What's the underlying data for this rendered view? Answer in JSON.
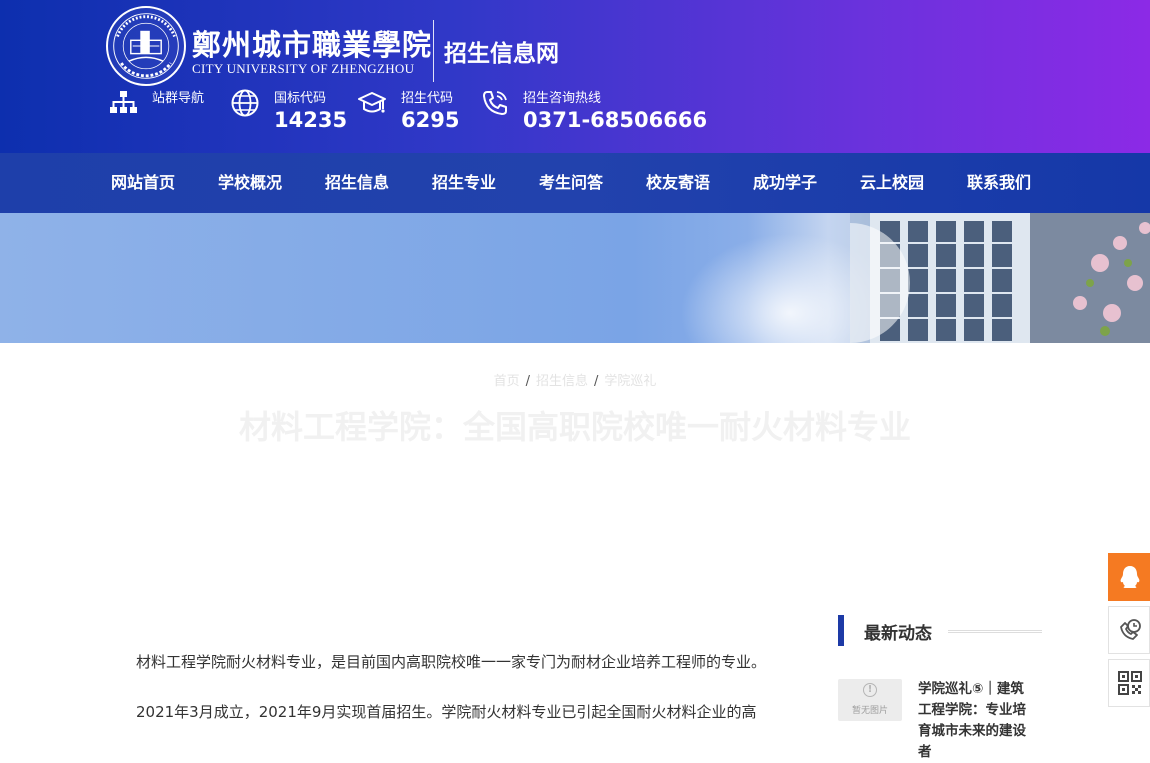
{
  "header": {
    "logo_cn": "鄭州城市職業學院",
    "logo_en": "CITY UNIVERSITY OF ZHENGZHOU",
    "site_name": "招生信息网",
    "info": [
      {
        "label": "站群导航",
        "value": "",
        "icon": "sitemap-icon"
      },
      {
        "label": "国标代码",
        "value": "14235",
        "icon": "globe-icon"
      },
      {
        "label": "招生代码",
        "value": "6295",
        "icon": "graduation-cap-icon"
      },
      {
        "label": "招生咨询热线",
        "value": "0371-68506666",
        "icon": "phone-icon"
      }
    ]
  },
  "nav": {
    "items": [
      "网站首页",
      "学校概况",
      "招生信息",
      "招生专业",
      "考生问答",
      "校友寄语",
      "成功学子",
      "云上校园",
      "联系我们"
    ]
  },
  "breadcrumb": {
    "items": [
      "首页",
      "招生信息",
      "学院巡礼"
    ],
    "separator": "/"
  },
  "article": {
    "title": "材料工程学院：全国高职院校唯一耐火材料专业",
    "paragraphs": [
      "材料工程学院耐火材料专业，是目前国内高职院校唯一一家专门为耐材企业培养工程师的专业。",
      "2021年3月成立，2021年9月实现首届招生。学院耐火材料专业已引起全国耐火材料企业的高"
    ]
  },
  "sidebar": {
    "heading": "最新动态",
    "news": [
      {
        "thumb_caption": "暂无图片",
        "title": "学院巡礼⑤｜建筑工程学院：专业培育城市未来的建设者"
      }
    ]
  },
  "floating_tools": [
    "qq-icon",
    "phone-clock-icon",
    "qr-code-icon"
  ],
  "colors": {
    "header_start": "#0d2fae",
    "header_end": "#8c2ae6",
    "nav_bg": "#2242ad",
    "accent": "#1d3aa6",
    "qq_orange": "#f57a22"
  }
}
